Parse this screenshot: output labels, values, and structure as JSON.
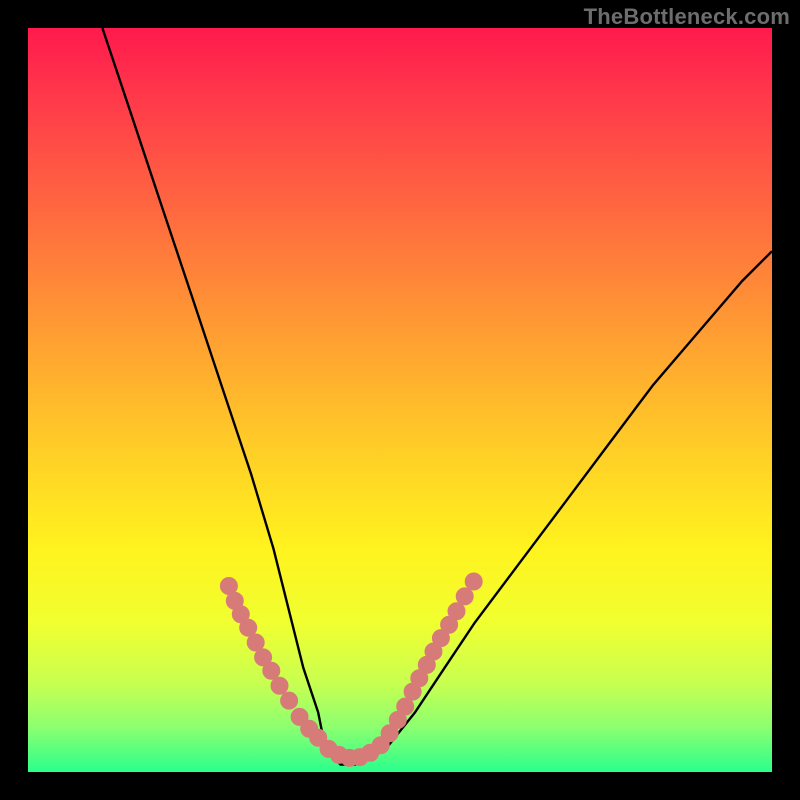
{
  "watermark": "TheBottleneck.com",
  "colors": {
    "frame": "#000000",
    "curve": "#000000",
    "dots": "#d77b78",
    "gradient_top": "#ff1a4d",
    "gradient_bottom": "#2aff8c"
  },
  "chart_data": {
    "type": "line",
    "title": "",
    "xlabel": "",
    "ylabel": "",
    "xlim": [
      0,
      100
    ],
    "ylim": [
      0,
      100
    ],
    "grid": false,
    "series": [
      {
        "name": "bottleneck-curve",
        "x": [
          10,
          14,
          18,
          22,
          26,
          30,
          33,
          35,
          37,
          39,
          40,
          42,
          44,
          48,
          52,
          56,
          60,
          66,
          72,
          78,
          84,
          90,
          96,
          100
        ],
        "y": [
          100,
          88,
          76,
          64,
          52,
          40,
          30,
          22,
          14,
          8,
          3,
          1,
          1,
          3,
          8,
          14,
          20,
          28,
          36,
          44,
          52,
          59,
          66,
          70
        ]
      }
    ],
    "highlight_clusters": [
      {
        "name": "left-segment-dots",
        "points": [
          {
            "x": 27.0,
            "y": 25.0
          },
          {
            "x": 27.8,
            "y": 23.0
          },
          {
            "x": 28.6,
            "y": 21.2
          },
          {
            "x": 29.6,
            "y": 19.4
          },
          {
            "x": 30.6,
            "y": 17.4
          },
          {
            "x": 31.6,
            "y": 15.4
          },
          {
            "x": 32.7,
            "y": 13.6
          },
          {
            "x": 33.8,
            "y": 11.6
          },
          {
            "x": 35.1,
            "y": 9.6
          },
          {
            "x": 36.5,
            "y": 7.4
          },
          {
            "x": 37.8,
            "y": 5.8
          },
          {
            "x": 39.0,
            "y": 4.6
          }
        ]
      },
      {
        "name": "valley-dots",
        "points": [
          {
            "x": 40.4,
            "y": 3.1
          },
          {
            "x": 41.8,
            "y": 2.3
          },
          {
            "x": 43.2,
            "y": 1.9
          },
          {
            "x": 44.6,
            "y": 2.0
          },
          {
            "x": 46.0,
            "y": 2.6
          },
          {
            "x": 47.4,
            "y": 3.6
          }
        ]
      },
      {
        "name": "right-segment-dots",
        "points": [
          {
            "x": 48.6,
            "y": 5.2
          },
          {
            "x": 49.7,
            "y": 7.0
          },
          {
            "x": 50.7,
            "y": 8.8
          },
          {
            "x": 51.7,
            "y": 10.8
          },
          {
            "x": 52.6,
            "y": 12.6
          },
          {
            "x": 53.6,
            "y": 14.4
          },
          {
            "x": 54.5,
            "y": 16.2
          },
          {
            "x": 55.5,
            "y": 18.0
          },
          {
            "x": 56.6,
            "y": 19.8
          },
          {
            "x": 57.6,
            "y": 21.6
          },
          {
            "x": 58.7,
            "y": 23.6
          },
          {
            "x": 59.9,
            "y": 25.6
          }
        ]
      }
    ]
  }
}
